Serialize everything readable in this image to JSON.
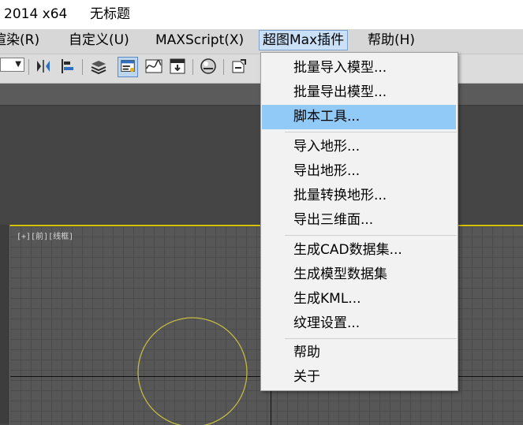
{
  "window": {
    "title_version": "2014 x64",
    "title_doc": "无标题"
  },
  "menubar": {
    "items": [
      {
        "label": "渲染(R)"
      },
      {
        "label": "自定义(U)"
      },
      {
        "label": "MAXScript(X)"
      },
      {
        "label": "超图Max插件"
      },
      {
        "label": "帮助(H)"
      }
    ]
  },
  "toolbar": {
    "icons": [
      "named-selection-combo",
      "mirror-icon",
      "align-icon",
      "layer-manager-icon",
      "scene-explorer-icon",
      "curve-editor-icon",
      "schematic-view-icon",
      "material-editor-icon",
      "render-setup-icon"
    ]
  },
  "viewport": {
    "label": "[+][前][线框]"
  },
  "dropdown": {
    "groups": [
      [
        "批量导入模型...",
        "批量导出模型...",
        "脚本工具..."
      ],
      [
        "导入地形...",
        "导出地形...",
        "批量转换地形...",
        "导出三维面..."
      ],
      [
        "生成CAD数据集...",
        "生成模型数据集",
        "生成KML...",
        "纹理设置..."
      ],
      [
        "帮助",
        "关于"
      ]
    ],
    "highlighted": "脚本工具..."
  },
  "colors": {
    "menu_highlight": "#91c9f7",
    "viewport_border": "#d6c200",
    "circle": "#c8c040"
  }
}
